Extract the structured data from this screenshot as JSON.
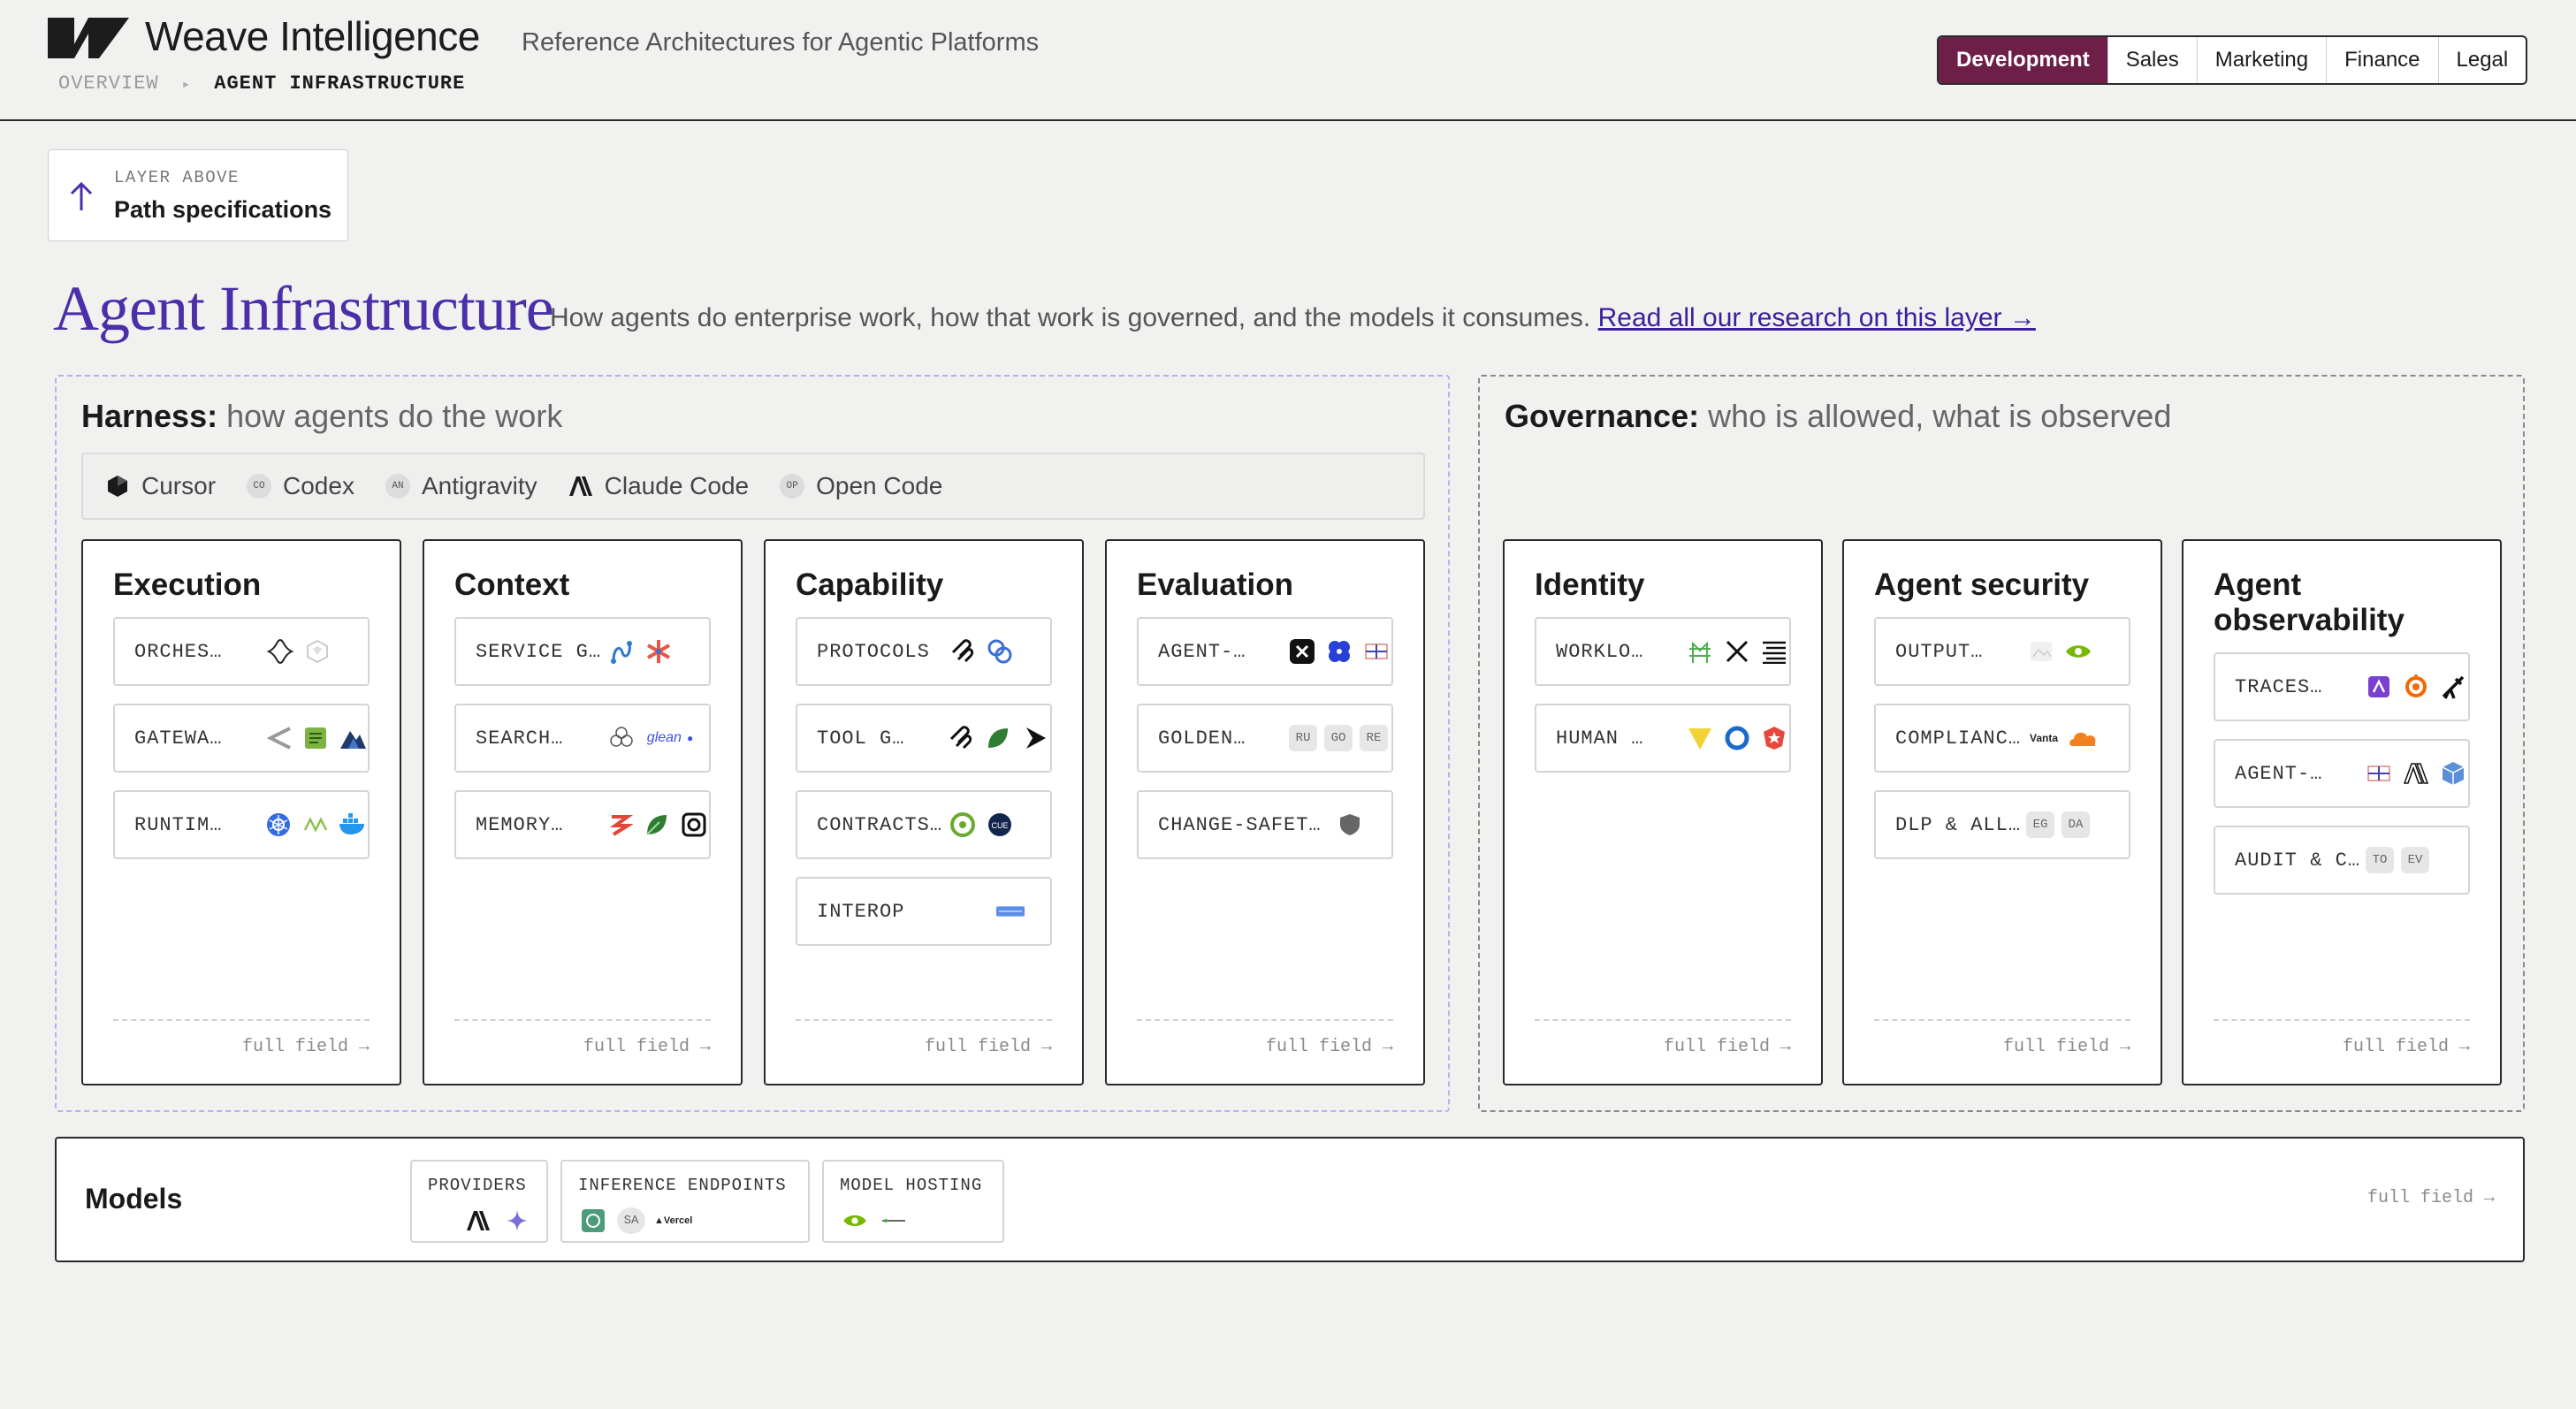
{
  "header": {
    "brand": "Weave Intelligence",
    "tagline": "Reference Architectures for Agentic Platforms",
    "breadcrumb": [
      "OVERVIEW",
      "AGENT INFRASTRUCTURE"
    ],
    "tabs": [
      "Development",
      "Sales",
      "Marketing",
      "Finance",
      "Legal"
    ],
    "active_tab": "Development"
  },
  "layer_above": {
    "label": "LAYER ABOVE",
    "value": "Path specifications"
  },
  "page": {
    "title": "Agent Infrastructure",
    "description": "How agents do enterprise work, how that work is governed, and the models it consumes.",
    "link": "Read all our research on this layer →"
  },
  "harness": {
    "title_bold": "Harness:",
    "title_rest": " how agents do the work",
    "tools": [
      {
        "name": "Cursor",
        "icon": "cube-icon"
      },
      {
        "name": "Codex",
        "badge": "CO"
      },
      {
        "name": "Antigravity",
        "badge": "AN"
      },
      {
        "name": "Claude Code",
        "icon": "anthropic-icon"
      },
      {
        "name": "Open Code",
        "badge": "OP"
      }
    ]
  },
  "governance": {
    "title_bold": "Governance:",
    "title_rest": " who is allowed, what is observed"
  },
  "cards": [
    {
      "title": "Execution",
      "items": [
        "ORCHES…",
        "GATEWA…",
        "RUNTIM…"
      ],
      "footer": "full field →"
    },
    {
      "title": "Context",
      "items": [
        "SERVICE G…",
        "SEARCH…",
        "MEMORY…"
      ],
      "footer": "full field →"
    },
    {
      "title": "Capability",
      "items": [
        "PROTOCOLS",
        "TOOL G…",
        "CONTRACTS…",
        "INTEROP"
      ],
      "footer": "full field →"
    },
    {
      "title": "Evaluation",
      "items": [
        "AGENT-…",
        "GOLDEN…",
        "CHANGE-SAFET…"
      ],
      "footer": "full field →",
      "pills": [
        "RU",
        "GO",
        "RE"
      ]
    },
    {
      "title": "Identity",
      "items": [
        "WORKLO…",
        "HUMAN …"
      ],
      "footer": "full field →"
    },
    {
      "title": "Agent security",
      "items": [
        "OUTPUT…",
        "COMPLIANC…",
        "DLP & ALL…"
      ],
      "footer": "full field →",
      "pills": [
        "EG",
        "DA"
      ],
      "vanta": "Vanta"
    },
    {
      "title": "Agent observability",
      "items": [
        "TRACES…",
        "AGENT-…",
        "AUDIT & C…"
      ],
      "footer": "full field →",
      "pills": [
        "TO",
        "EV"
      ]
    }
  ],
  "models": {
    "title": "Models",
    "groups": [
      {
        "label": "PROVIDERS"
      },
      {
        "label": "INFERENCE ENDPOINTS",
        "pill": "SA",
        "text": "▲Vercel"
      },
      {
        "label": "MODEL HOSTING"
      }
    ],
    "footer": "full field →"
  },
  "context_text": {
    "glean": "glean"
  },
  "colors": {
    "accent": "#6e1f48",
    "title": "#4a2fa8",
    "harness_border": "#b9b0ec"
  }
}
